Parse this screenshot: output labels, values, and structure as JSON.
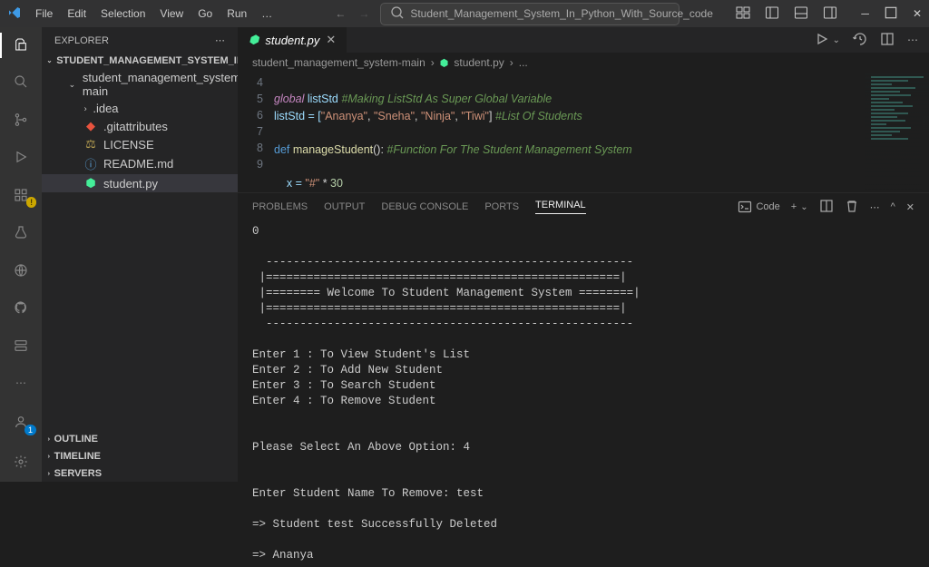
{
  "menu": {
    "file": "File",
    "edit": "Edit",
    "selection": "Selection",
    "view": "View",
    "go": "Go",
    "run": "Run",
    "more": "…"
  },
  "search_title": "Student_Management_System_In_Python_With_Source_code",
  "sidebar": {
    "header": "EXPLORER",
    "project": "STUDENT_MANAGEMENT_SYSTEM_IN_PYTHON...",
    "folder": "student_management_system-main",
    "items": [
      {
        "name": ".idea",
        "type": "folder"
      },
      {
        "name": ".gitattributes",
        "type": "git"
      },
      {
        "name": "LICENSE",
        "type": "lic"
      },
      {
        "name": "README.md",
        "type": "md"
      },
      {
        "name": "student.py",
        "type": "py",
        "selected": true
      }
    ],
    "outline": "OUTLINE",
    "timeline": "TIMELINE",
    "servers": "SERVERS"
  },
  "tab": {
    "name": "student.py"
  },
  "crumbs": {
    "a": "student_management_system-main",
    "b": "student.py",
    "c": "..."
  },
  "editor": {
    "lines": [
      "4",
      "5",
      "6",
      "7",
      "8",
      "9"
    ],
    "l4_kw": "global",
    "l4_var": " listStd ",
    "l4_com": "#Making ListStd As Super Global Variable",
    "l5_a": "listStd = [",
    "l5_s1": "\"Ananya\"",
    "l5_c1": ", ",
    "l5_s2": "\"Sneha\"",
    "l5_c2": ", ",
    "l5_s3": "\"Ninja\"",
    "l5_c3": ", ",
    "l5_s4": "\"Tiwi\"",
    "l5_b": "] ",
    "l5_com": "#List Of Students",
    "l7_kw": "def",
    "l7_fn": " manageStudent",
    "l7_p": "(): ",
    "l7_com": "#Function For The Student Management System",
    "l9": "    x = ",
    "l9_s": "\"#\"",
    "l9_b": " * ",
    "l9_n": "30"
  },
  "panel": {
    "tabs": {
      "problems": "PROBLEMS",
      "output": "OUTPUT",
      "debug": "DEBUG CONSOLE",
      "ports": "PORTS",
      "terminal": "TERMINAL"
    },
    "right_label": "Code"
  },
  "terminal": "0\n\n  ------------------------------------------------------\n |====================================================|\n |======== Welcome To Student Management System ========|\n |====================================================|\n  ------------------------------------------------------\n\nEnter 1 : To View Student's List\nEnter 2 : To Add New Student\nEnter 3 : To Search Student\nEnter 4 : To Remove Student\n\n\nPlease Select An Above Option: 4\n\n\nEnter Student Name To Remove: test\n\n=> Student test Successfully Deleted\n\n=> Ananya"
}
